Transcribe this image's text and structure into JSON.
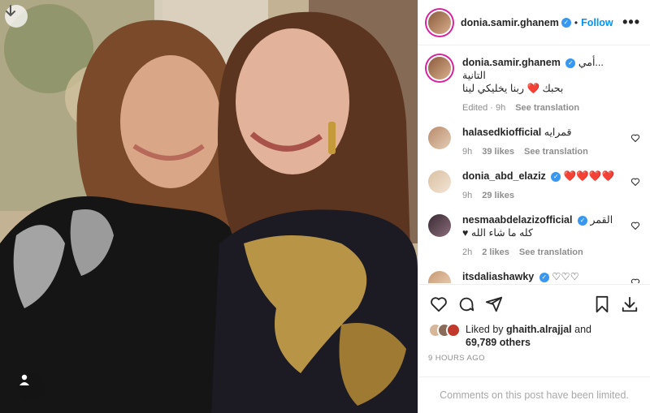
{
  "post": {
    "author": "donia.samir.ghanem",
    "follow_label": "Follow",
    "dot": "•",
    "more": "•••"
  },
  "caption": {
    "author": "donia.samir.ghanem",
    "line1": "...أمي التانية",
    "line2": "بحبك ❤️ ربنا يخليكي لينا",
    "edited": "Edited · 9h",
    "see_translation": "See translation"
  },
  "comments": [
    {
      "user": "halasedkiofficial",
      "verified": false,
      "text": "قمرايه",
      "time": "9h",
      "likes": "39 likes",
      "translation": "See translation"
    },
    {
      "user": "donia_abd_elaziz",
      "verified": true,
      "text": "❤️❤️❤️❤️",
      "time": "9h",
      "likes": "29 likes",
      "translation": ""
    },
    {
      "user": "nesmaabdelazizofficial",
      "verified": true,
      "text": "القمر كله ما شاء الله ♥",
      "time": "2h",
      "likes": "2 likes",
      "translation": "See translation"
    },
    {
      "user": "itsdaliashawky",
      "verified": true,
      "text": "♡♡♡",
      "time": "",
      "likes": "",
      "translation": ""
    }
  ],
  "likes": {
    "prefix": "Liked by",
    "user": "ghaith.alrajjal",
    "and": "and",
    "others": "69,789 others"
  },
  "timestamp": "9 HOURS AGO",
  "limited_notice": "Comments on this post have been limited.",
  "colors": {
    "accent": "#0095f6",
    "verified": "#3897f0",
    "heart": "#ed4956",
    "muted": "#8e8e8e"
  },
  "icons": [
    "download-icon",
    "tag-person-icon",
    "like-icon",
    "comment-icon",
    "share-icon",
    "save-icon",
    "download-post-icon",
    "more-options-icon"
  ]
}
